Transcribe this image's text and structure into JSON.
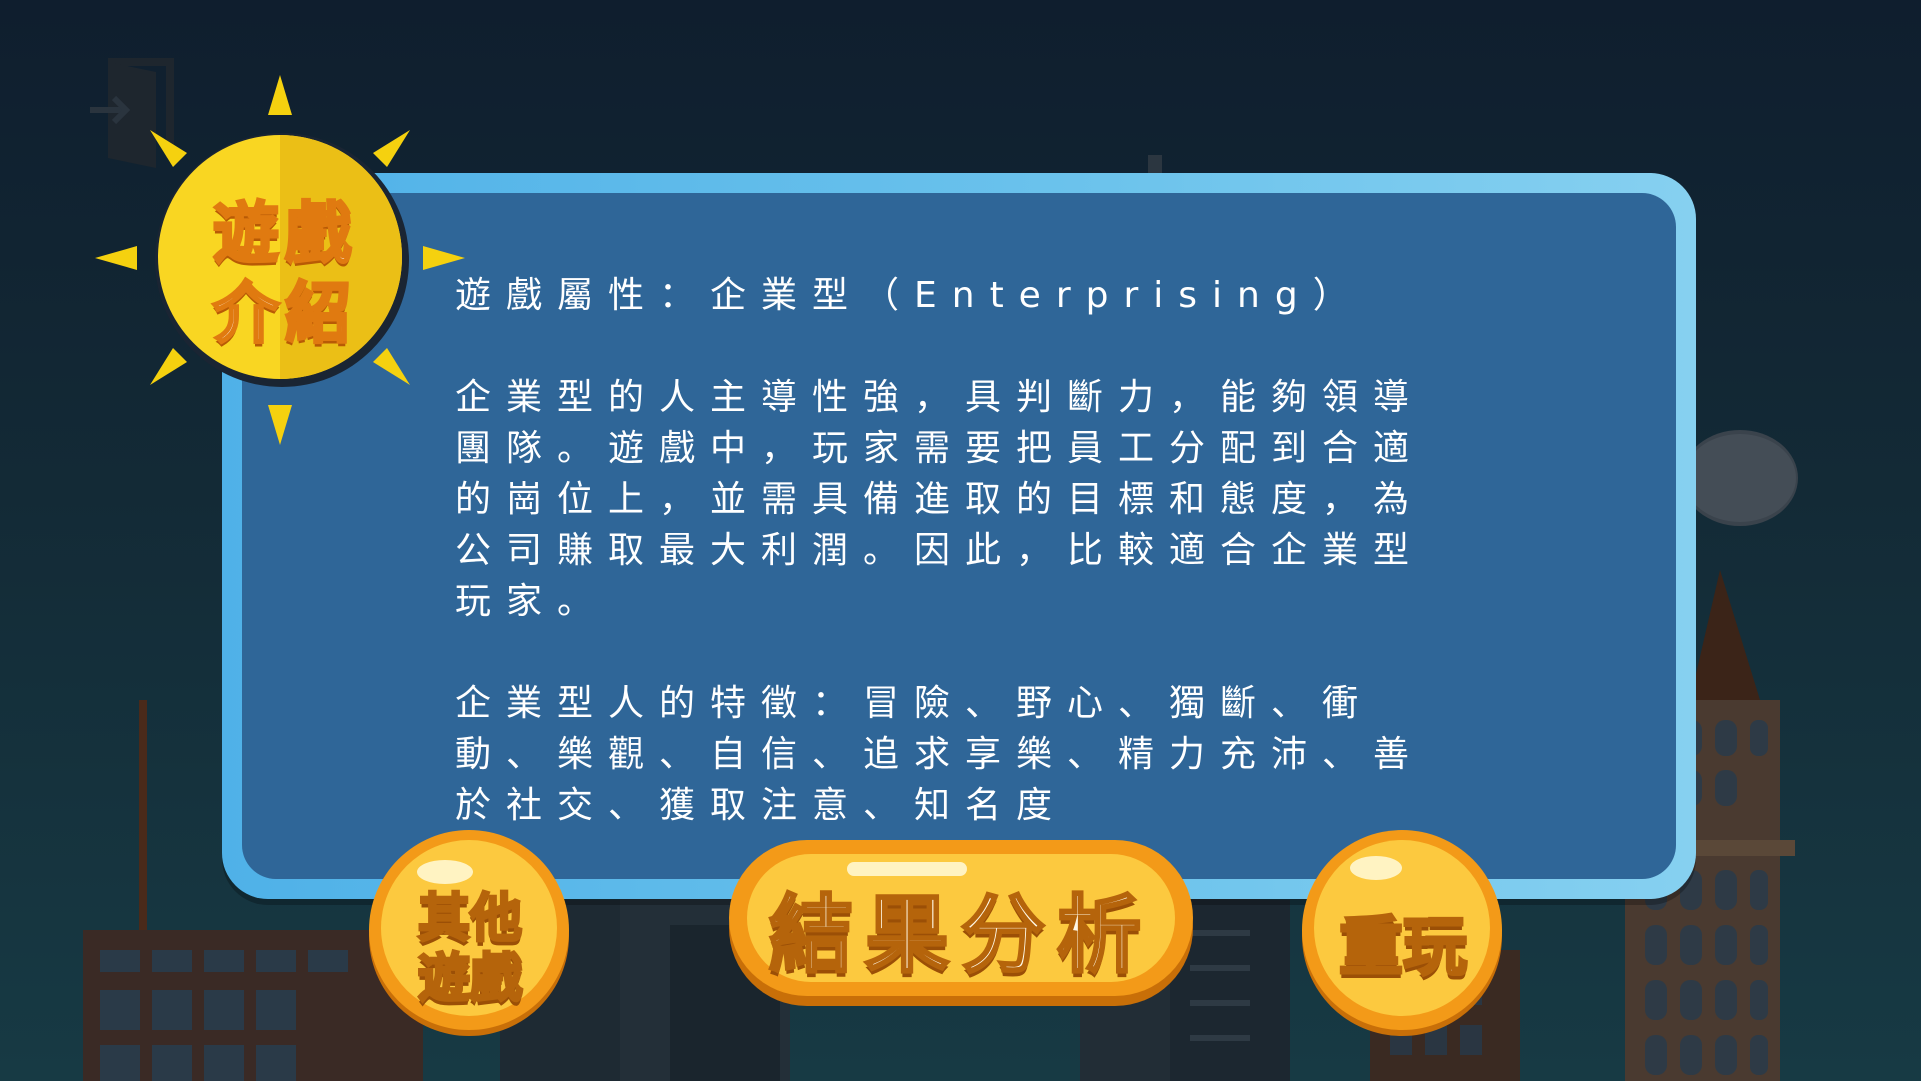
{
  "title": {
    "line1": "遊戲",
    "line2": "介紹"
  },
  "panel": {
    "attribute": "遊戲屬性：企業型（Enterprising）",
    "description": "企業型的人主導性強，具判斷力，能夠領導團隊。遊戲中，玩家需要把員工分配到合適的崗位上，並需具備進取的目標和態度，為公司賺取最大利潤。因此，比較適合企業型玩家。",
    "traits": "企業型人的特徵：冒險、野心、獨斷、衝動、樂觀、自信、追求享樂、精力充沛、善於社交、獲取注意、知名度"
  },
  "buttons": {
    "other_line1": "其他",
    "other_line2": "遊戲",
    "analysis": "結果分析",
    "replay": "重玩"
  },
  "icons": {
    "exit": "exit-door-icon",
    "sun": "sun-icon"
  },
  "colors": {
    "background": "#132a36",
    "panel_border": "#6cc3ec",
    "panel_fill": "#2f6698",
    "sun_yellow": "#f7d21a",
    "button_orange": "#f49b1c",
    "button_yellow": "#fcd34a"
  }
}
